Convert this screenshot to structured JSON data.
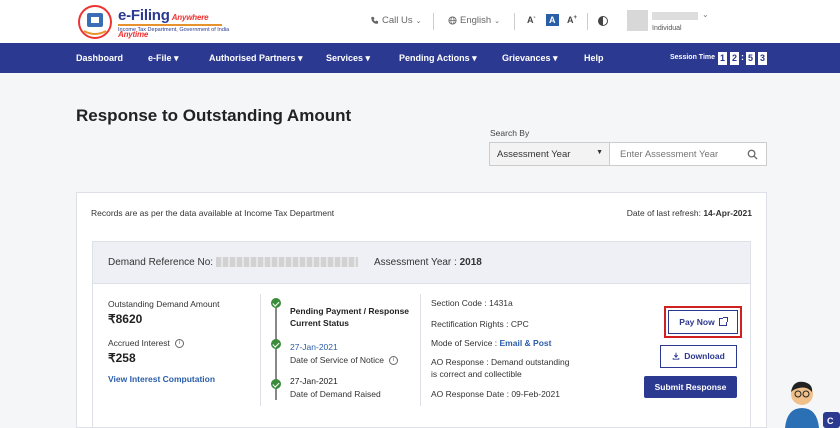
{
  "header": {
    "logo_title": "e-Filing",
    "logo_tagline": "Anywhere Anytime",
    "logo_subtitle": "Income Tax Department, Government of India",
    "call_us": "Call Us",
    "language": "English",
    "font_small": "A",
    "font_normal": "A",
    "font_large": "A",
    "user_role": "Individual"
  },
  "nav": {
    "items": [
      "Dashboard",
      "e-File ▾",
      "Authorised Partners ▾",
      "Services ▾",
      "Pending Actions ▾",
      "Grievances ▾",
      "Help"
    ],
    "session_label": "Session Time",
    "session_digits": [
      "1",
      "2",
      "5",
      "3"
    ]
  },
  "page": {
    "title": "Response to Outstanding Amount",
    "search_by_label": "Search By",
    "search_select": "Assessment Year",
    "search_placeholder": "Enter Assessment Year"
  },
  "records": {
    "note": "Records are as per the data available at Income Tax Department",
    "refresh_label": "Date of last refresh:",
    "refresh_date": "14-Apr-2021"
  },
  "demand": {
    "ref_label": "Demand Reference No:",
    "ay_label": "Assessment Year :",
    "ay_value": "2018",
    "outstanding_label": "Outstanding Demand Amount",
    "outstanding_value": "₹8620",
    "accrued_label": "Accrued Interest",
    "accrued_value": "₹258",
    "view_interest": "View Interest Computation",
    "timeline": {
      "status_title_1": "Pending Payment / Response",
      "status_title_2": "Current Status",
      "notice_date": "27-Jan-2021",
      "notice_desc": "Date of Service of Notice",
      "raised_date": "27-Jan-2021",
      "raised_desc": "Date of Demand Raised"
    },
    "section_code": "Section Code : 1431a",
    "rectification": "Rectification Rights : CPC",
    "mode_label": "Mode of Service :",
    "mode_value": "Email & Post",
    "ao_response_1": "AO Response : Demand outstanding",
    "ao_response_2": "is correct and collectible",
    "ao_response_date": "AO Response Date : 09-Feb-2021",
    "pay_now": "Pay Now",
    "download": "Download",
    "submit": "Submit Response"
  }
}
